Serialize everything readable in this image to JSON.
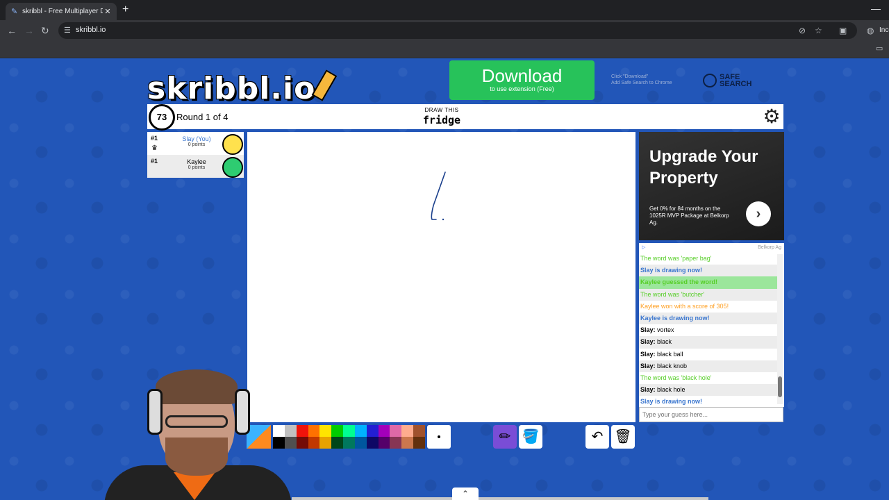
{
  "browser": {
    "tab_title": "skribbl - Free Multiplayer Draw",
    "tab_close": "✕",
    "new_tab": "+",
    "url": "skribbl.io",
    "incognito_label": "Inco"
  },
  "header": {
    "logo_text": "skribbl.io",
    "download_title": "Download",
    "download_sub": "to use extension (Free)",
    "click_hint_1": "Click \"Download\"",
    "click_hint_2": "Add Safe Search to Chrome",
    "safe_search_1": "SAFE",
    "safe_search_2": "SEARCH"
  },
  "game": {
    "timer": "73",
    "round": "Round 1 of 4",
    "draw_this": "DRAW THIS",
    "word": "fridge"
  },
  "players": [
    {
      "rank": "#1",
      "name": "Slay (You)",
      "points": "0 points",
      "avatar_color": "#ffe14d",
      "name_color": "#3975ce"
    },
    {
      "rank": "#1",
      "name": "Kaylee",
      "points": "0 points",
      "avatar_color": "#2ecc71",
      "name_color": "#000000"
    }
  ],
  "ad": {
    "headline_1": "Upgrade Your",
    "headline_2": "Property",
    "body": "Get 0% for 84 months on the 1025R MVP Package at Belkorp Ag.",
    "advertiser": "Belkorp Ag"
  },
  "chat": {
    "messages": [
      {
        "type": "green",
        "name": "",
        "text": "The word was 'paper bag'"
      },
      {
        "type": "blue",
        "name": "",
        "text": "Slay is drawing now!"
      },
      {
        "type": "greenbg",
        "name": "",
        "text": "Kaylee guessed the word!"
      },
      {
        "type": "green",
        "name": "",
        "text": "The word was 'butcher'"
      },
      {
        "type": "orange",
        "name": "",
        "text": "Kaylee won with a score of 305!"
      },
      {
        "type": "blue",
        "name": "",
        "text": "Kaylee is drawing now!"
      },
      {
        "type": "blk",
        "name": "Slay:",
        "text": " vortex"
      },
      {
        "type": "blk",
        "name": "Slay:",
        "text": " black"
      },
      {
        "type": "blk",
        "name": "Slay:",
        "text": " black ball"
      },
      {
        "type": "blk",
        "name": "Slay:",
        "text": " black knob"
      },
      {
        "type": "green",
        "name": "",
        "text": "The word was 'black hole'"
      },
      {
        "type": "blk",
        "name": "Slay:",
        "text": " black hole"
      },
      {
        "type": "blue",
        "name": "",
        "text": "Slay is drawing now!"
      }
    ],
    "placeholder": "Type your guess here..."
  },
  "palette": {
    "top": [
      "#ffffff",
      "#c1c1c1",
      "#ef130b",
      "#ff7100",
      "#ffe400",
      "#00cc00",
      "#00ff91",
      "#00b2ff",
      "#231fd3",
      "#a300ba",
      "#df69a7",
      "#ffac8e",
      "#a0522d"
    ],
    "bottom": [
      "#000000",
      "#505050",
      "#740b07",
      "#c23800",
      "#e8a200",
      "#004619",
      "#00785d",
      "#00569e",
      "#0e0865",
      "#550069",
      "#873554",
      "#cc774d",
      "#63300d"
    ]
  },
  "accent": "#7a4dd6"
}
